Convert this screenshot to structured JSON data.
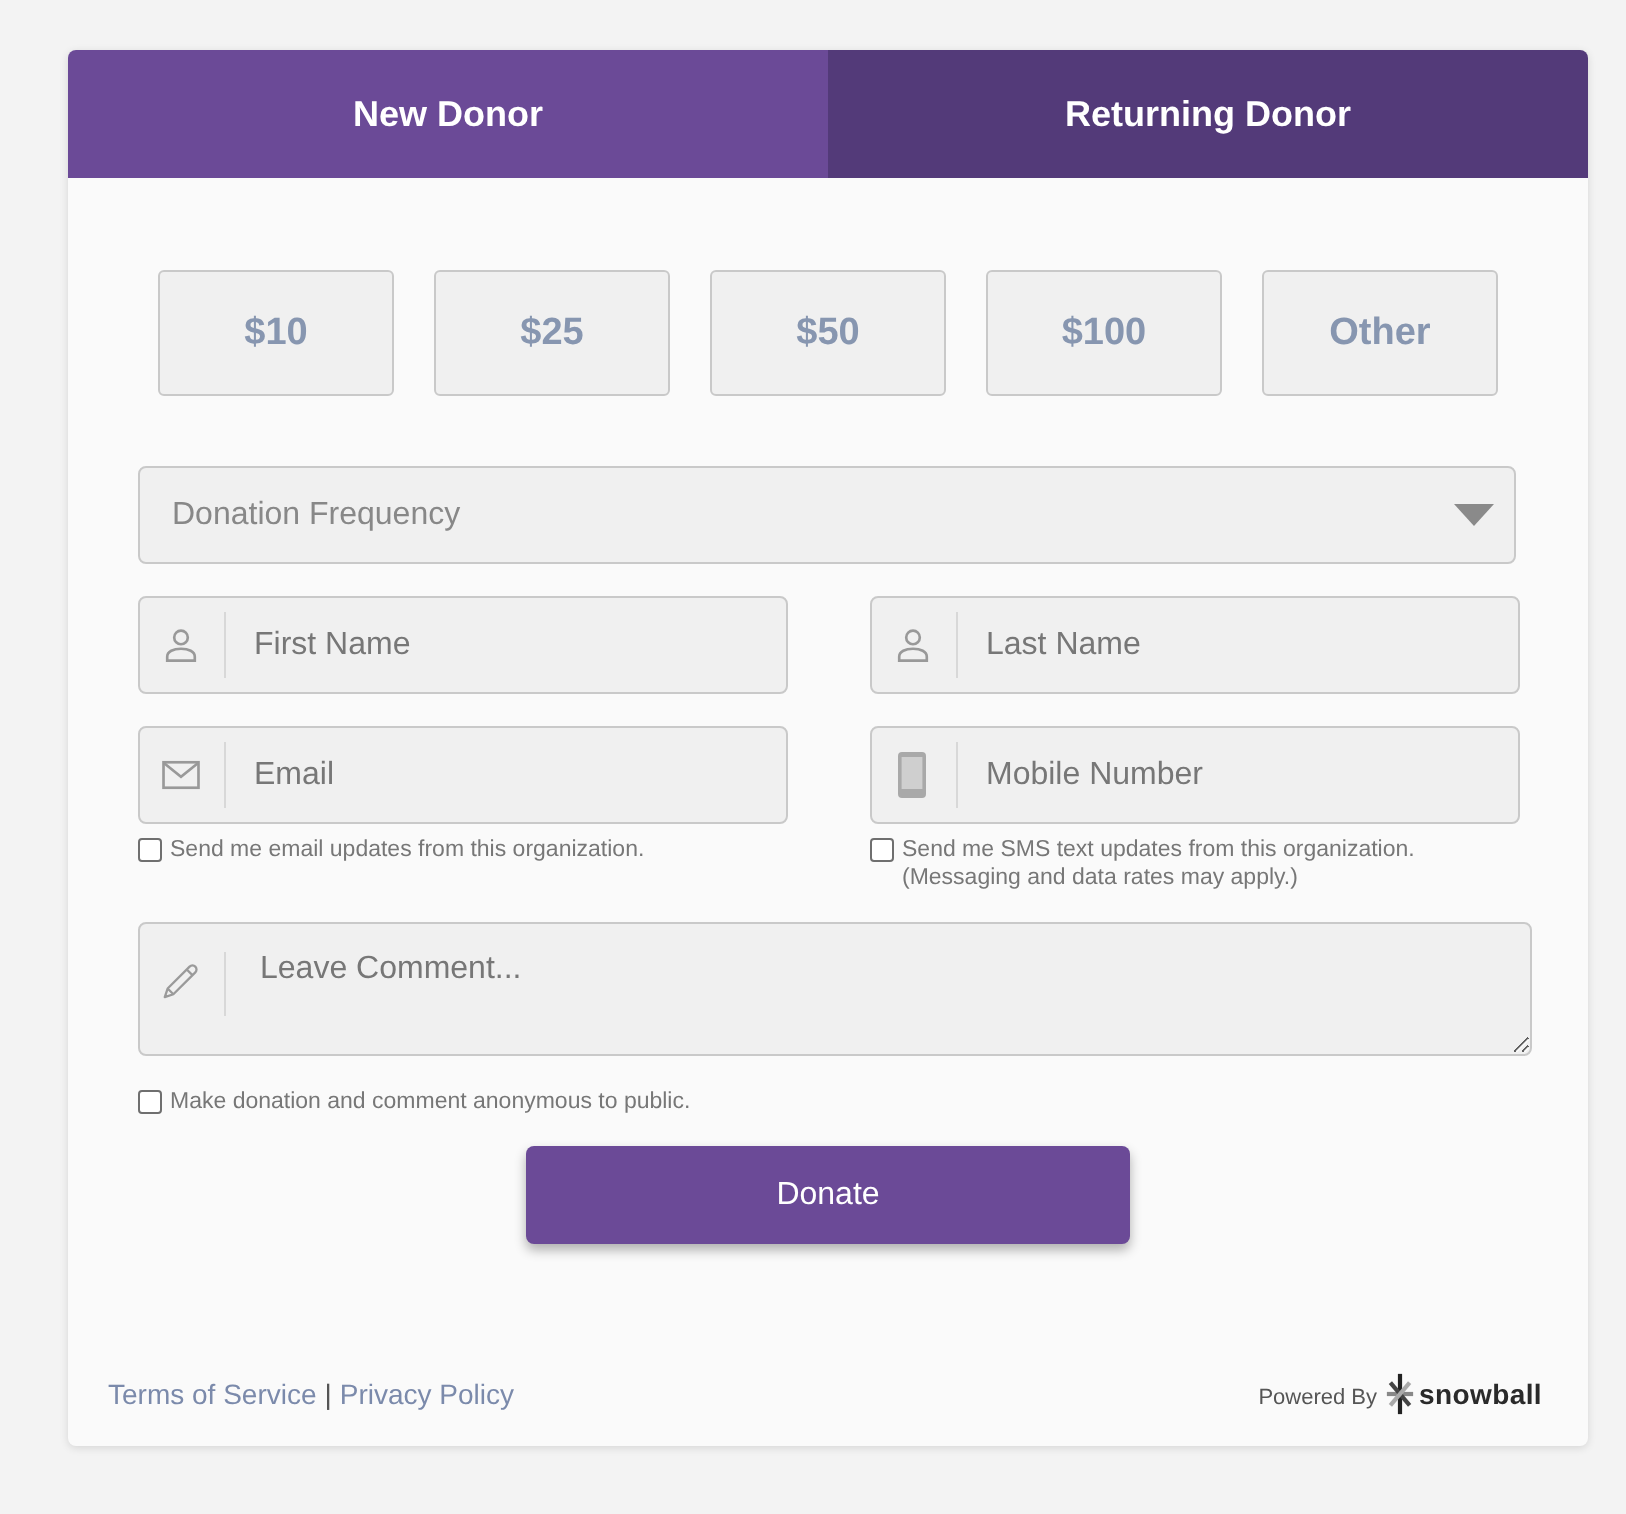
{
  "tabs": [
    {
      "label": "New Donor",
      "selected": true
    },
    {
      "label": "Returning Donor",
      "selected": false
    }
  ],
  "amounts": [
    {
      "label": "$10",
      "selected": false
    },
    {
      "label": "$25",
      "selected": false
    },
    {
      "label": "$50",
      "selected": false
    },
    {
      "label": "$100",
      "selected": false
    },
    {
      "label": "Other",
      "selected": false
    }
  ],
  "frequency_select": {
    "placeholder": "Donation Frequency"
  },
  "fields": [
    {
      "kind": "person",
      "placeholder": "First Name"
    },
    {
      "kind": "person",
      "placeholder": "Last Name"
    },
    {
      "kind": "email",
      "placeholder": "Email",
      "opt_in": {
        "label": "Send me email updates from this organization.",
        "checked": false
      }
    },
    {
      "kind": "phone",
      "placeholder": "Mobile Number",
      "opt_in": {
        "label": "Send me SMS text updates from this organization.\n(Messaging and data rates may apply.)",
        "checked": false
      }
    }
  ],
  "comment": {
    "placeholder": "Leave Comment..."
  },
  "anonymous": {
    "label": "Make donation and comment anonymous to public.",
    "checked": false
  },
  "donate_button": {
    "label": "Donate"
  },
  "footer": {
    "links": [
      "Terms of Service",
      "Privacy Policy"
    ],
    "separator": "|",
    "powered_by": "Powered By",
    "brand": "snowball"
  }
}
